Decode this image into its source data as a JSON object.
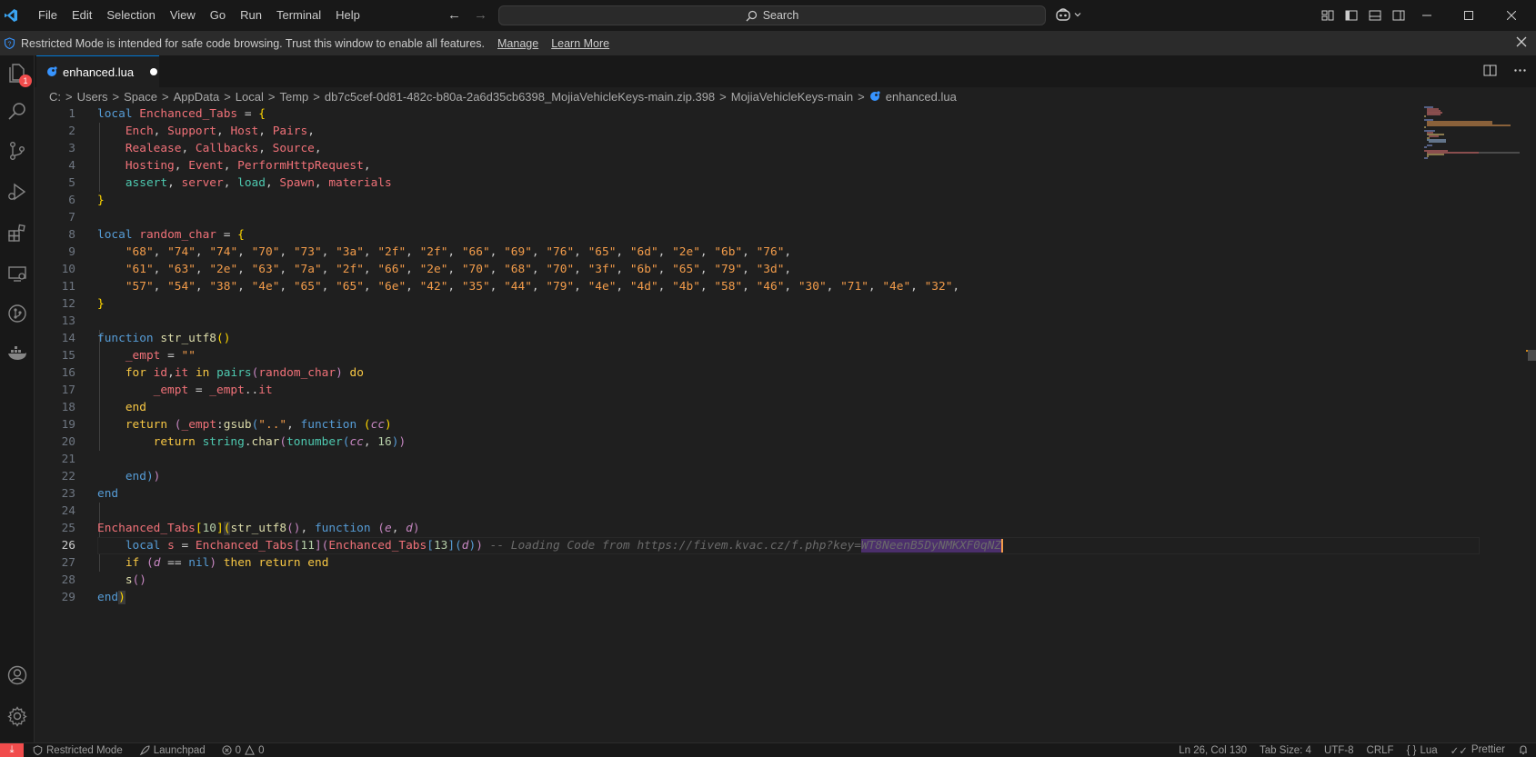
{
  "menu": [
    "File",
    "Edit",
    "Selection",
    "View",
    "Go",
    "Run",
    "Terminal",
    "Help"
  ],
  "search": {
    "label": "Search"
  },
  "banner": {
    "text": "Restricted Mode is intended for safe code browsing. Trust this window to enable all features.",
    "manage": "Manage",
    "learn_more": "Learn More"
  },
  "activity": {
    "badge_count": "1"
  },
  "tab": {
    "filename": "enhanced.lua"
  },
  "breadcrumb": [
    "C:",
    "Users",
    "Space",
    "AppData",
    "Local",
    "Temp",
    "db7c5cef-0d81-482c-b80a-2a6d35cb6398_MojiaVehicleKeys-main.zip.398",
    "MojiaVehicleKeys-main",
    "enhanced.lua"
  ],
  "editor": {
    "current_line": 26,
    "line_count": 29,
    "comment": "-- Loading Code from https://fivem.kvac.cz/f.php?key=",
    "selected_key": "WT8NeenB5DyNMKXF0qNZ"
  },
  "status": {
    "mode": "Restricted Mode",
    "launchpad": "Launchpad",
    "problems": "0",
    "warnings": "0",
    "position": "Ln 26, Col 130",
    "tab_size": "Tab Size: 4",
    "encoding": "UTF-8",
    "eol": "CRLF",
    "language": "Lua",
    "formatter": "Prettier"
  },
  "colors": {
    "accent": "#0078d4",
    "badge": "#f14c4c",
    "background": "#1f1f1f"
  }
}
